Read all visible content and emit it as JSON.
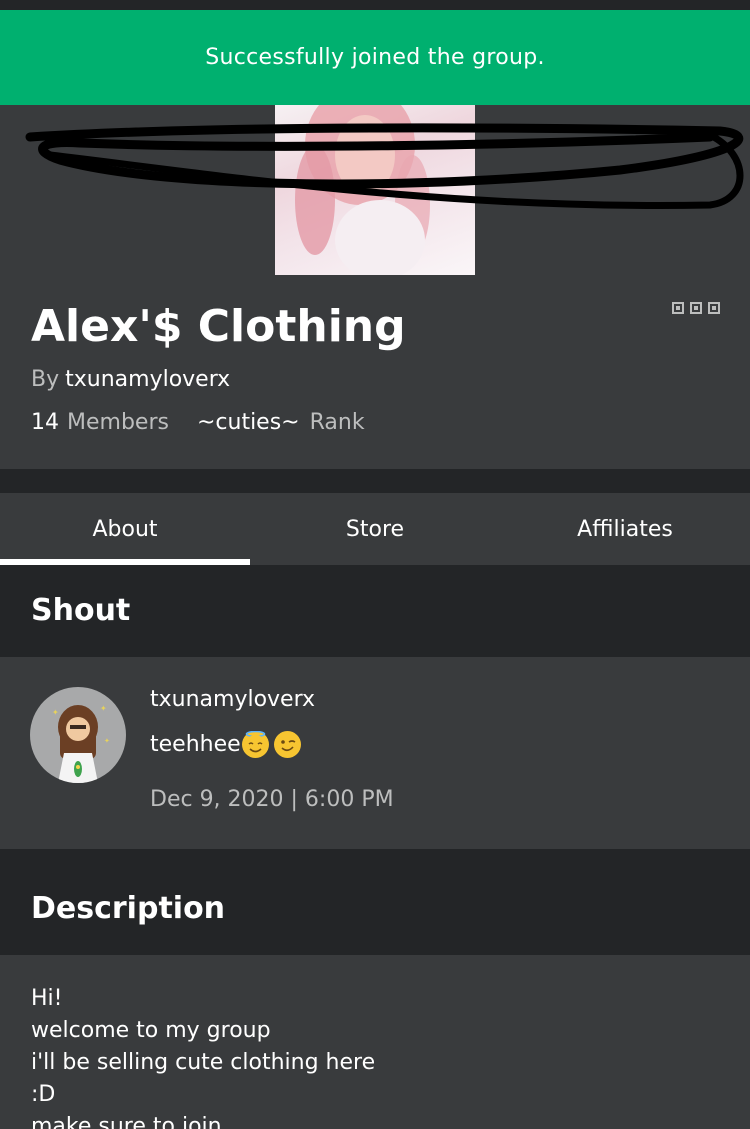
{
  "notification": {
    "message": "Successfully joined the group."
  },
  "group": {
    "name": "Alex'$ Clothing",
    "by_label": "By",
    "owner": "txunamyloverx",
    "member_count": "14",
    "members_label": "Members",
    "rank_name": "~cuties~",
    "rank_label": "Rank"
  },
  "tabs": [
    {
      "label": "About",
      "active": true
    },
    {
      "label": "Store",
      "active": false
    },
    {
      "label": "Affiliates",
      "active": false
    }
  ],
  "shout": {
    "title": "Shout",
    "username": "txunamyloverx",
    "message": "teehhee",
    "emojis": [
      "smiling-face-with-halo",
      "winking-face"
    ],
    "timestamp": "Dec 9, 2020 | 6:00 PM"
  },
  "description": {
    "title": "Description",
    "lines": [
      "Hi!",
      "welcome to my group",
      "i'll be selling cute clothing here",
      ":D",
      "make sure to join"
    ]
  },
  "colors": {
    "toast_green": "#00b06f",
    "page_bg": "#232527",
    "card_bg": "#393b3d",
    "muted_text": "#bdbebe"
  },
  "icons": {
    "more_menu": "more-dots-icon"
  }
}
